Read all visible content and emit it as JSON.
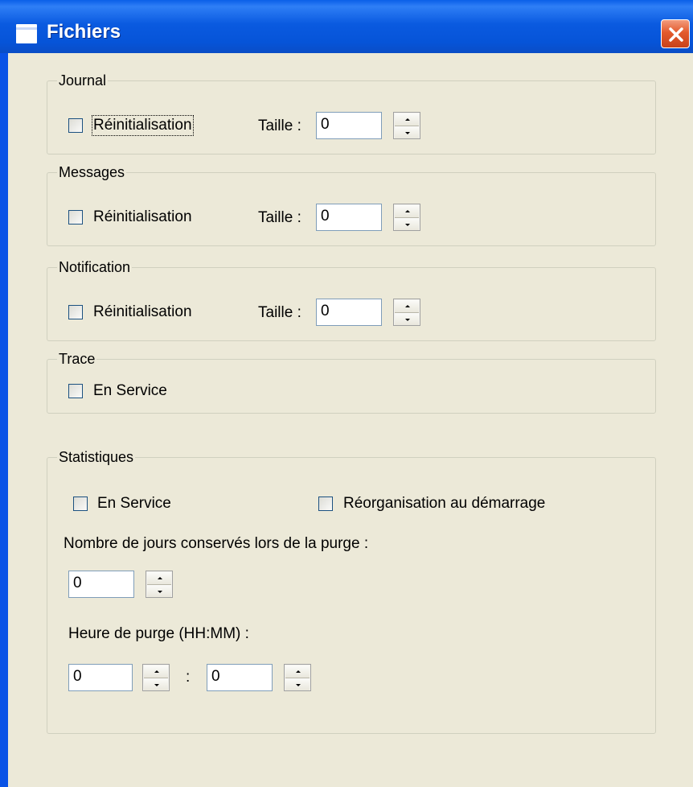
{
  "window": {
    "title": "Fichiers"
  },
  "journal": {
    "legend": "Journal",
    "reset_label": "Réinitialisation",
    "size_label": "Taille :",
    "size_value": "0"
  },
  "messages": {
    "legend": "Messages",
    "reset_label": "Réinitialisation",
    "size_label": "Taille :",
    "size_value": "0"
  },
  "notification": {
    "legend": "Notification",
    "reset_label": "Réinitialisation",
    "size_label": "Taille :",
    "size_value": "0"
  },
  "trace": {
    "legend": "Trace",
    "enabled_label": "En Service"
  },
  "statistiques": {
    "legend": "Statistiques",
    "enabled_label": "En Service",
    "reorg_label": "Réorganisation au démarrage",
    "days_label": "Nombre de jours conservés lors de la purge :",
    "days_value": "0",
    "purge_time_label": "Heure de purge (HH:MM) :",
    "hours_value": "0",
    "separator": ":",
    "minutes_value": "0"
  },
  "icons": {
    "window": "window-icon",
    "close": "close-icon",
    "spin_up": "up-arrow-icon",
    "spin_down": "down-arrow-icon"
  }
}
